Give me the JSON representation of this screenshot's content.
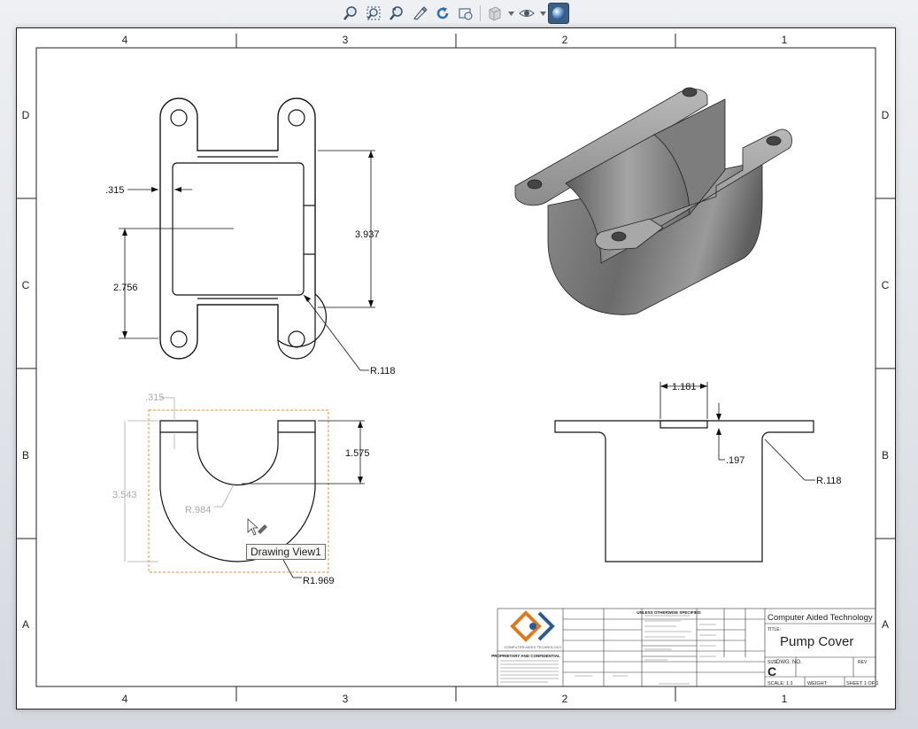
{
  "toolbar": {
    "items": [
      "zoom-to-fit-icon",
      "zoom-to-area-icon",
      "previous-view-icon",
      "sketch-pan-icon",
      "rotate-view-icon",
      "view-settings-icon",
      "display-style-icon",
      "hide-show-icon",
      "appearance-icon"
    ]
  },
  "zones": {
    "columns": [
      "4",
      "3",
      "2",
      "1"
    ],
    "rows": [
      "D",
      "C",
      "B",
      "A"
    ]
  },
  "views": {
    "top": {
      "dims": {
        "wall": ".315",
        "height": "3.937",
        "offset": "2.756",
        "fillet": "R.118"
      }
    },
    "front": {
      "dims": {
        "wall": ".315",
        "depth": "1.575",
        "height": "3.543",
        "inner_radius": "R.984",
        "outer_radius": "R1.969"
      }
    },
    "right": {
      "dims": {
        "flange_width": "1.181",
        "thickness": ".197",
        "fillet": "R.118"
      }
    }
  },
  "tooltip": {
    "text": "Drawing View1"
  },
  "title_block": {
    "company": "Computer Aided Technology",
    "title_label": "TITLE:",
    "title": "Pump Cover",
    "size_label": "SIZE",
    "size": "C",
    "dwg_no_label": "DWG. NO.",
    "rev_label": "REV",
    "scale": "SCALE: 1:1",
    "weight": "WEIGHT:",
    "sheet": "SHEET 1 OF 1",
    "unless": "UNLESS OTHERWISE SPECIFIED:",
    "proprietary": "PROPRIETARY AND CONFIDENTIAL",
    "logo_text": "COMPUTER AIDED TECHNOLOGY"
  }
}
